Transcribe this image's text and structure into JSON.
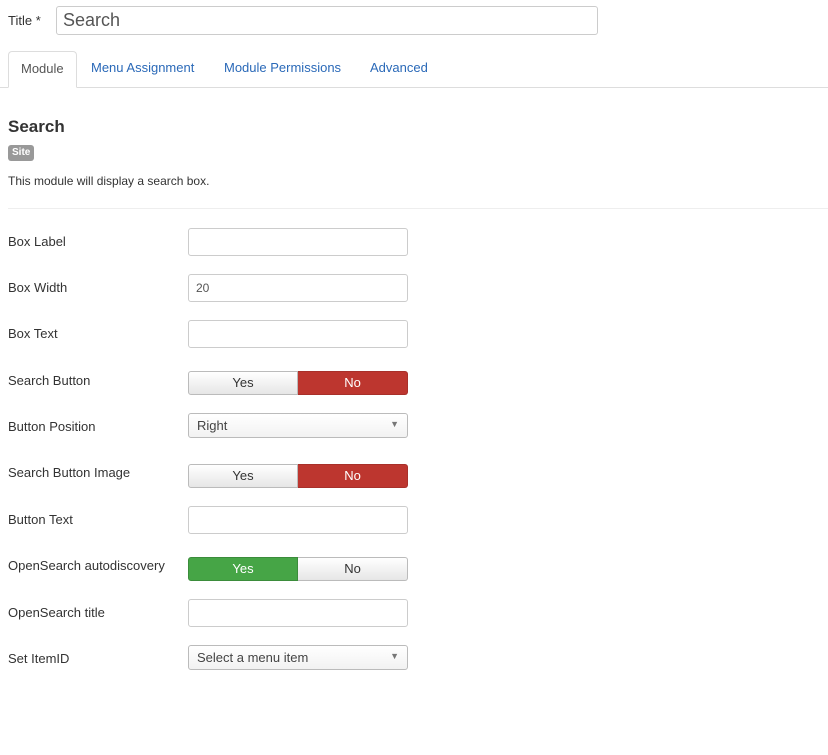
{
  "title_field": {
    "label": "Title *",
    "value": "Search"
  },
  "tabs": [
    {
      "label": "Module",
      "active": true
    },
    {
      "label": "Menu Assignment",
      "active": false
    },
    {
      "label": "Module Permissions",
      "active": false
    },
    {
      "label": "Advanced",
      "active": false
    }
  ],
  "module": {
    "title": "Search",
    "badge": "Site",
    "description": "This module will display a search box."
  },
  "fields": {
    "box_label": {
      "label": "Box Label",
      "value": ""
    },
    "box_width": {
      "label": "Box Width",
      "value": "20"
    },
    "box_text": {
      "label": "Box Text",
      "value": ""
    },
    "search_button": {
      "label": "Search Button",
      "yes": "Yes",
      "no": "No",
      "selected": "No"
    },
    "button_position": {
      "label": "Button Position",
      "value": "Right"
    },
    "search_button_image": {
      "label": "Search Button Image",
      "yes": "Yes",
      "no": "No",
      "selected": "No"
    },
    "button_text": {
      "label": "Button Text",
      "value": ""
    },
    "opensearch_autodiscovery": {
      "label": "OpenSearch autodiscovery",
      "yes": "Yes",
      "no": "No",
      "selected": "Yes"
    },
    "opensearch_title": {
      "label": "OpenSearch title",
      "value": ""
    },
    "set_itemid": {
      "label": "Set ItemID",
      "value": "Select a menu item"
    }
  },
  "colors": {
    "link": "#2a69b8",
    "no_active": "#bd362f",
    "yes_active": "#46a546",
    "badge": "#999999"
  }
}
